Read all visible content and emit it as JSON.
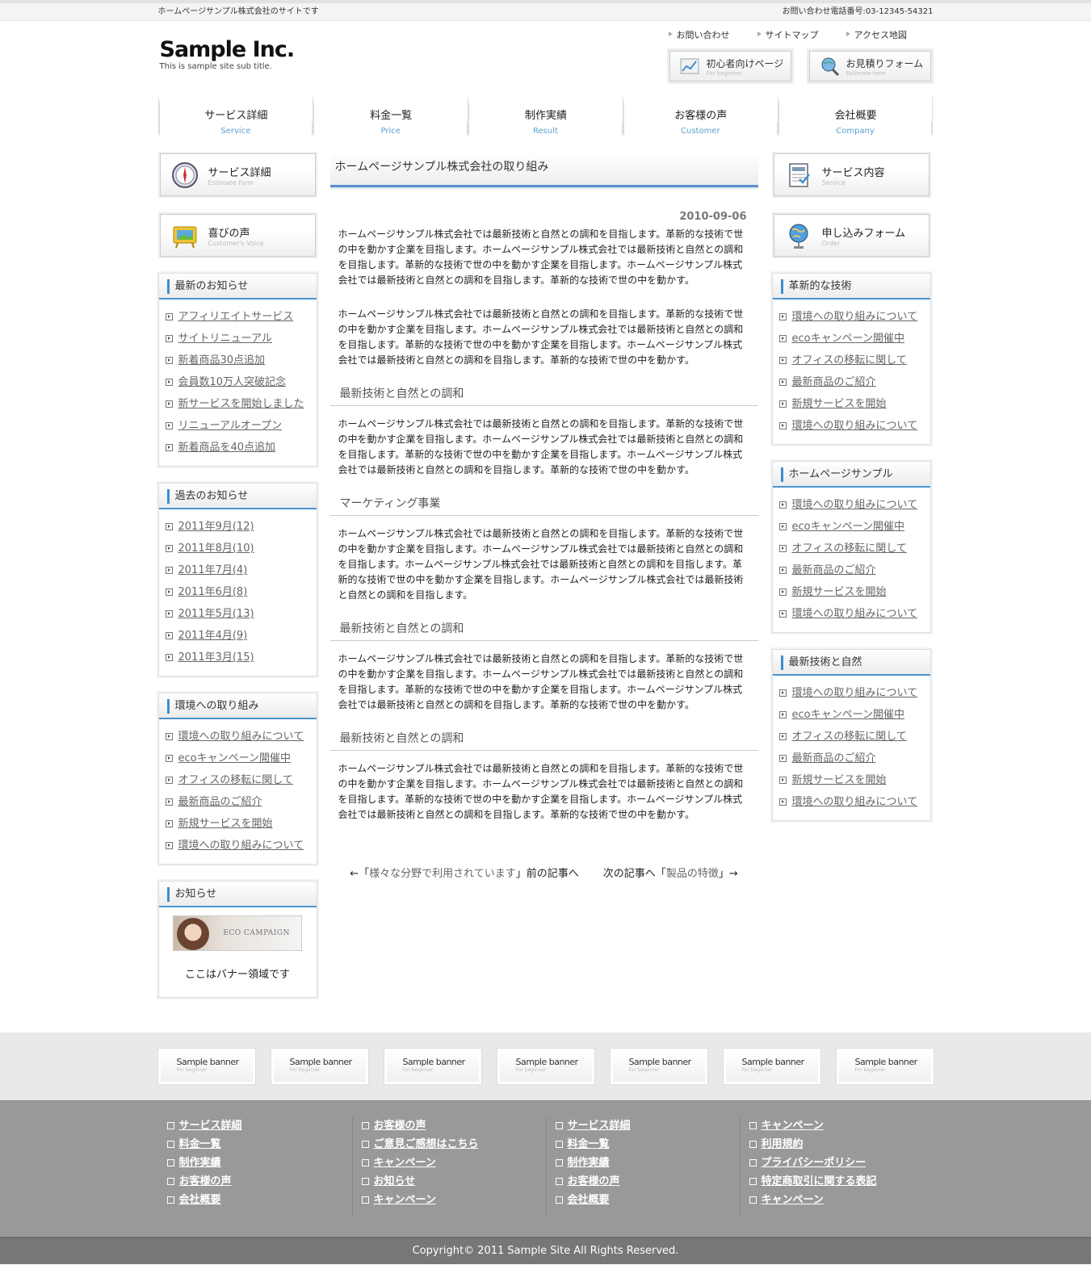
{
  "topbar": {
    "left": "ホームページサンプル株式会社のサイトです",
    "right": "お問い合わせ電話番号:03-12345-54321"
  },
  "logo": {
    "name": "Sample Inc.",
    "sub": "This is sample site sub title."
  },
  "toplinks": [
    "お問い合わせ",
    "サイトマップ",
    "アクセス地図"
  ],
  "header_buttons": [
    {
      "title": "初心者向けページ",
      "sub": "For beginner",
      "icon": "chart-icon"
    },
    {
      "title": "お見積りフォーム",
      "sub": "Estimate form",
      "icon": "magnifier-globe-icon"
    }
  ],
  "gnav": [
    {
      "ja": "サービス詳細",
      "en": "Service"
    },
    {
      "ja": "料金一覧",
      "en": "Price"
    },
    {
      "ja": "制作実績",
      "en": "Result"
    },
    {
      "ja": "お客様の声",
      "en": "Customer"
    },
    {
      "ja": "会社概要",
      "en": "Company"
    }
  ],
  "left": {
    "buttons": [
      {
        "title": "サービス詳細",
        "sub": "Estimate form",
        "icon": "compass-icon"
      },
      {
        "title": "喜びの声",
        "sub": "Customer's Voice",
        "icon": "display-board-icon"
      }
    ],
    "boxes": [
      {
        "title": "最新のお知らせ",
        "items": [
          "アフィリエイトサービス",
          "サイトリニューアル",
          "新着商品30点追加",
          "会員数10万人突破記念",
          "新サービスを開始しました",
          "リニューアルオープン",
          "新着商品を40点追加"
        ]
      },
      {
        "title": "過去のお知らせ",
        "items": [
          "2011年9月(12)",
          "2011年8月(10)",
          "2011年7月(4)",
          "2011年6月(8)",
          "2011年5月(13)",
          "2011年4月(9)",
          "2011年3月(15)"
        ]
      },
      {
        "title": "環境への取り組み",
        "items": [
          "環境への取り組みについて",
          "ecoキャンペーン開催中",
          "オフィスの移転に関して",
          "最新商品のご紹介",
          "新規サービスを開始",
          "環境への取り組みについて"
        ]
      }
    ],
    "notice": {
      "title": "お知らせ",
      "banner_text": "ECO CAMPAIGN",
      "caption": "ここはバナー領域です"
    }
  },
  "main": {
    "title": "ホームページサンプル株式会社の取り組み",
    "date": "2010-09-06",
    "p1": "ホームページサンプル株式会社では最新技術と自然との調和を目指します。革新的な技術で世の中を動かす企業を目指します。ホームページサンプル株式会社では最新技術と自然との調和を目指します。革新的な技術で世の中を動かす企業を目指します。ホームページサンプル株式会社では最新技術と自然との調和を目指します。革新的な技術で世の中を動かす。",
    "p2": "ホームページサンプル株式会社では最新技術と自然との調和を目指します。革新的な技術で世の中を動かす企業を目指します。ホームページサンプル株式会社では最新技術と自然との調和を目指します。革新的な技術で世の中を動かす企業を目指します。ホームページサンプル株式会社では最新技術と自然との調和を目指します。革新的な技術で世の中を動かす。",
    "sections": [
      {
        "heading": "最新技術と自然との調和",
        "text": "ホームページサンプル株式会社では最新技術と自然との調和を目指します。革新的な技術で世の中を動かす企業を目指します。ホームページサンプル株式会社では最新技術と自然との調和を目指します。革新的な技術で世の中を動かす企業を目指します。ホームページサンプル株式会社では最新技術と自然との調和を目指します。革新的な技術で世の中を動かす。"
      },
      {
        "heading": "マーケティング事業",
        "text": "ホームページサンプル株式会社では最新技術と自然との調和を目指します。革新的な技術で世の中を動かす企業を目指します。ホームページサンプル株式会社では最新技術と自然との調和を目指します。ホームページサンプル株式会社では最新技術と自然との調和を目指します。革新的な技術で世の中を動かす企業を目指します。ホームページサンプル株式会社では最新技術と自然との調和を目指します。"
      },
      {
        "heading": "最新技術と自然との調和",
        "text": "ホームページサンプル株式会社では最新技術と自然との調和を目指します。革新的な技術で世の中を動かす企業を目指します。ホームページサンプル株式会社では最新技術と自然との調和を目指します。革新的な技術で世の中を動かす企業を目指します。ホームページサンプル株式会社では最新技術と自然との調和を目指します。革新的な技術で世の中を動かす。"
      },
      {
        "heading": "最新技術と自然との調和",
        "text": "ホームページサンプル株式会社では最新技術と自然との調和を目指します。革新的な技術で世の中を動かす企業を目指します。ホームページサンプル株式会社では最新技術と自然との調和を目指します。革新的な技術で世の中を動かす企業を目指します。ホームページサンプル株式会社では最新技術と自然との調和を目指します。革新的な技術で世の中を動かす。"
      }
    ],
    "pager": {
      "prev_pre": "←「",
      "prev_link": "様々な分野で利用されています",
      "prev_post": "」前の記事へ",
      "next_pre": "次の記事へ「",
      "next_link": "製品の特徴",
      "next_post": "」→"
    }
  },
  "right": {
    "buttons": [
      {
        "title": "サービス内容",
        "sub": "Service",
        "icon": "ticket-icon"
      },
      {
        "title": "申し込みフォーム",
        "sub": "Order",
        "icon": "globe-icon"
      }
    ],
    "boxes": [
      {
        "title": "革新的な技術",
        "items": [
          "環境への取り組みについて",
          "ecoキャンペーン開催中",
          "オフィスの移転に関して",
          "最新商品のご紹介",
          "新規サービスを開始",
          "環境への取り組みについて"
        ]
      },
      {
        "title": "ホームページサンプル",
        "items": [
          "環境への取り組みについて",
          "ecoキャンペーン開催中",
          "オフィスの移転に関して",
          "最新商品のご紹介",
          "新規サービスを開始",
          "環境への取り組みについて"
        ]
      },
      {
        "title": "最新技術と自然",
        "items": [
          "環境への取り組みについて",
          "ecoキャンペーン開催中",
          "オフィスの移転に関して",
          "最新商品のご紹介",
          "新規サービスを開始",
          "環境への取り組みについて"
        ]
      }
    ]
  },
  "sample_banners": [
    {
      "title": "Sample banner",
      "sub": "For beginner"
    },
    {
      "title": "Sample banner",
      "sub": "For beginner"
    },
    {
      "title": "Sample banner",
      "sub": "For beginner"
    },
    {
      "title": "Sample banner",
      "sub": "For beginner"
    },
    {
      "title": "Sample banner",
      "sub": "For beginner"
    },
    {
      "title": "Sample banner",
      "sub": "For beginner"
    },
    {
      "title": "Sample banner",
      "sub": "For beginner"
    }
  ],
  "footer_nav": [
    [
      "サービス詳細",
      "料金一覧",
      "制作実績",
      "お客様の声",
      "会社概要"
    ],
    [
      "お客様の声",
      "ご意見ご感想はこちら",
      "キャンペーン",
      "お知らせ",
      "キャンペーン"
    ],
    [
      "サービス詳細",
      "料金一覧",
      "制作実績",
      "お客様の声",
      "会社概要"
    ],
    [
      "キャンペーン",
      "利用規約",
      "プライバシーポリシー",
      "特定商取引に関する表記",
      "キャンペーン"
    ]
  ],
  "copyright": "Copyright© 2011 Sample Site All Rights Reserved."
}
